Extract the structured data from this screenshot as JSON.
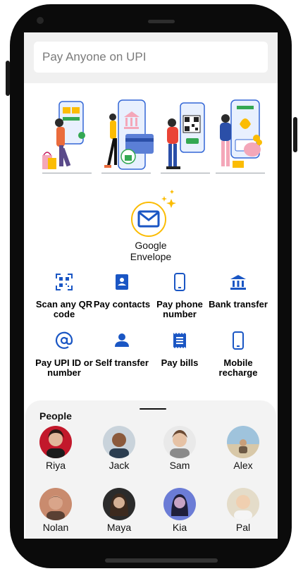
{
  "search": {
    "placeholder": "Pay Anyone on UPI"
  },
  "envelope": {
    "label_line1": "Google",
    "label_line2": "Envelope"
  },
  "actions": [
    {
      "label": "Scan any QR code",
      "icon": "qr-scan-icon"
    },
    {
      "label": "Pay contacts",
      "icon": "contacts-icon"
    },
    {
      "label": "Pay phone number",
      "icon": "phone-icon"
    },
    {
      "label": "Bank transfer",
      "icon": "bank-icon"
    },
    {
      "label": "Pay UPI ID or number",
      "icon": "at-icon"
    },
    {
      "label": "Self transfer",
      "icon": "person-icon"
    },
    {
      "label": "Pay bills",
      "icon": "bill-icon"
    },
    {
      "label": "Mobile recharge",
      "icon": "mobile-icon"
    }
  ],
  "people": {
    "title": "People",
    "list": [
      {
        "name": "Riya"
      },
      {
        "name": "Jack"
      },
      {
        "name": "Sam"
      },
      {
        "name": "Alex"
      },
      {
        "name": "Nolan"
      },
      {
        "name": "Maya"
      },
      {
        "name": "Kia"
      },
      {
        "name": "Pal"
      }
    ]
  },
  "colors": {
    "accent": "#1a56c4",
    "star": "#fbbc04",
    "sheet": "#f3f3f3"
  }
}
